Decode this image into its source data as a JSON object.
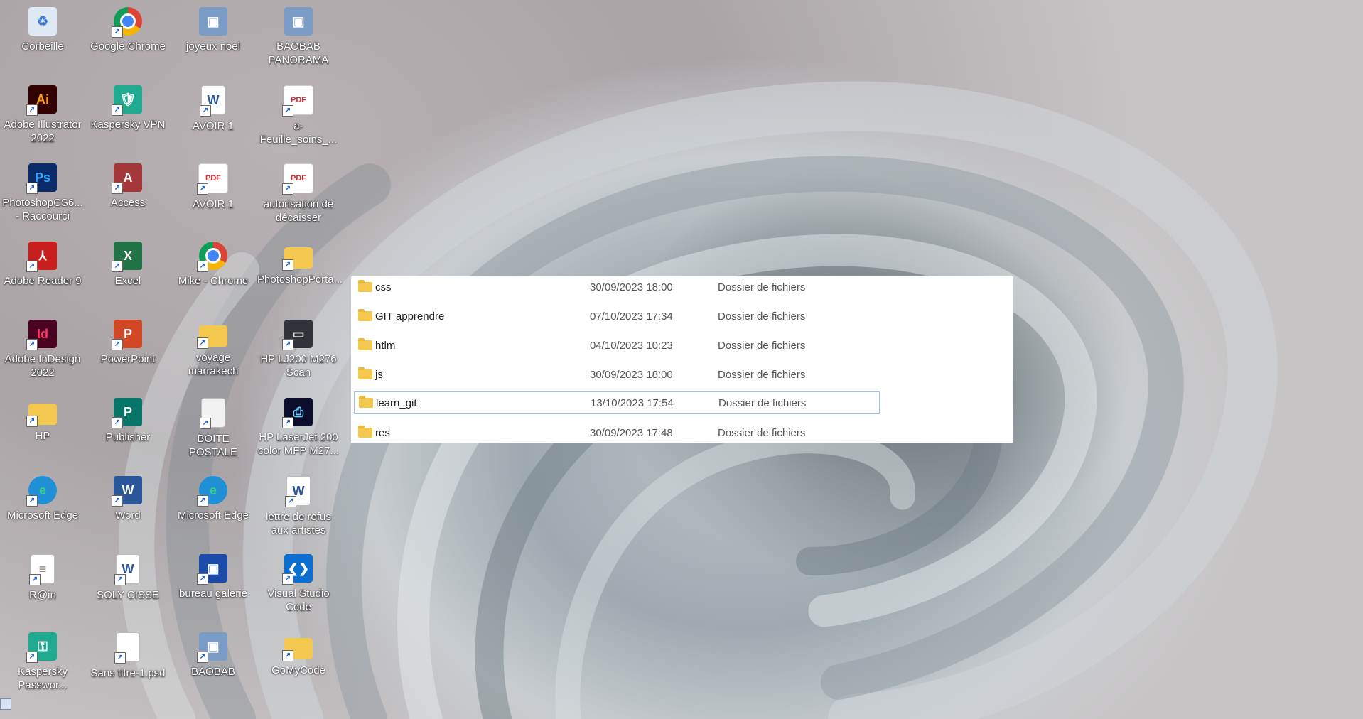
{
  "desktop": {
    "icons": [
      {
        "label": "Corbeille",
        "icon": "recycle-bin-icon"
      },
      {
        "label": "Google Chrome",
        "icon": "chrome-icon"
      },
      {
        "label": "joyeux noel",
        "icon": "image-icon"
      },
      {
        "label": "BAOBAB PANORAMA",
        "icon": "image-icon"
      },
      {
        "label": "Adobe Illustrator 2022",
        "icon": "illustrator-icon"
      },
      {
        "label": "Kaspersky VPN",
        "icon": "kaspersky-vpn-icon"
      },
      {
        "label": "AVOIR 1",
        "icon": "word-document-icon"
      },
      {
        "label": "a-Feuille_soins_...",
        "icon": "pdf-icon"
      },
      {
        "label": "PhotoshopCS6... - Raccourci",
        "icon": "photoshop-icon"
      },
      {
        "label": "Access",
        "icon": "access-icon"
      },
      {
        "label": "AVOIR 1",
        "icon": "pdf-icon"
      },
      {
        "label": "autorisation de décaisser",
        "icon": "pdf-icon"
      },
      {
        "label": "Adobe Reader 9",
        "icon": "adobe-reader-icon"
      },
      {
        "label": "Excel",
        "icon": "excel-icon"
      },
      {
        "label": "Mike - Chrome",
        "icon": "chrome-icon"
      },
      {
        "label": "PhotoshopPorta...",
        "icon": "folder-icon"
      },
      {
        "label": "Adobe InDesign 2022",
        "icon": "indesign-icon"
      },
      {
        "label": "PowerPoint",
        "icon": "powerpoint-icon"
      },
      {
        "label": "voyage marrakech",
        "icon": "folder-icon"
      },
      {
        "label": "HP LJ200 M276 Scan",
        "icon": "scanner-icon"
      },
      {
        "label": "HP",
        "icon": "folder-icon"
      },
      {
        "label": "Publisher",
        "icon": "publisher-icon"
      },
      {
        "label": "BOITE POSTALE",
        "icon": "document-icon"
      },
      {
        "label": "HP LaserJet 200 color MFP M27...",
        "icon": "printer-icon"
      },
      {
        "label": "Microsoft Edge",
        "icon": "edge-icon"
      },
      {
        "label": "Word",
        "icon": "word-icon"
      },
      {
        "label": "Microsoft Edge",
        "icon": "edge-icon"
      },
      {
        "label": "lettre de refus aux artistes",
        "icon": "word-document-icon"
      },
      {
        "label": "R@in",
        "icon": "text-file-icon"
      },
      {
        "label": "SOLY CISSE",
        "icon": "word-document-icon"
      },
      {
        "label": "bureau galerie",
        "icon": "remote-desktop-icon"
      },
      {
        "label": "Visual Studio Code",
        "icon": "vscode-icon"
      },
      {
        "label": "Kaspersky Passwor...",
        "icon": "kaspersky-password-icon"
      },
      {
        "label": "Sans titre-1.psd",
        "icon": "blank-file-icon"
      },
      {
        "label": "BAOBAB",
        "icon": "image-icon"
      },
      {
        "label": "GoMyCode",
        "icon": "folder-icon"
      }
    ]
  },
  "explorer": {
    "rows": [
      {
        "name": "css",
        "date": "30/09/2023 18:00",
        "type": "Dossier de fichiers",
        "selected": false
      },
      {
        "name": "GIT apprendre",
        "date": "07/10/2023 17:34",
        "type": "Dossier de fichiers",
        "selected": false
      },
      {
        "name": "htlm",
        "date": "04/10/2023 10:23",
        "type": "Dossier de fichiers",
        "selected": false
      },
      {
        "name": "js",
        "date": "30/09/2023 18:00",
        "type": "Dossier de fichiers",
        "selected": false
      },
      {
        "name": "learn_git",
        "date": "13/10/2023 17:54",
        "type": "Dossier de fichiers",
        "selected": true
      },
      {
        "name": "res",
        "date": "30/09/2023 17:48",
        "type": "Dossier de fichiers",
        "selected": false
      }
    ]
  },
  "colors": {
    "folder": "#f4c84f",
    "selection_border": "#96c3ff"
  }
}
